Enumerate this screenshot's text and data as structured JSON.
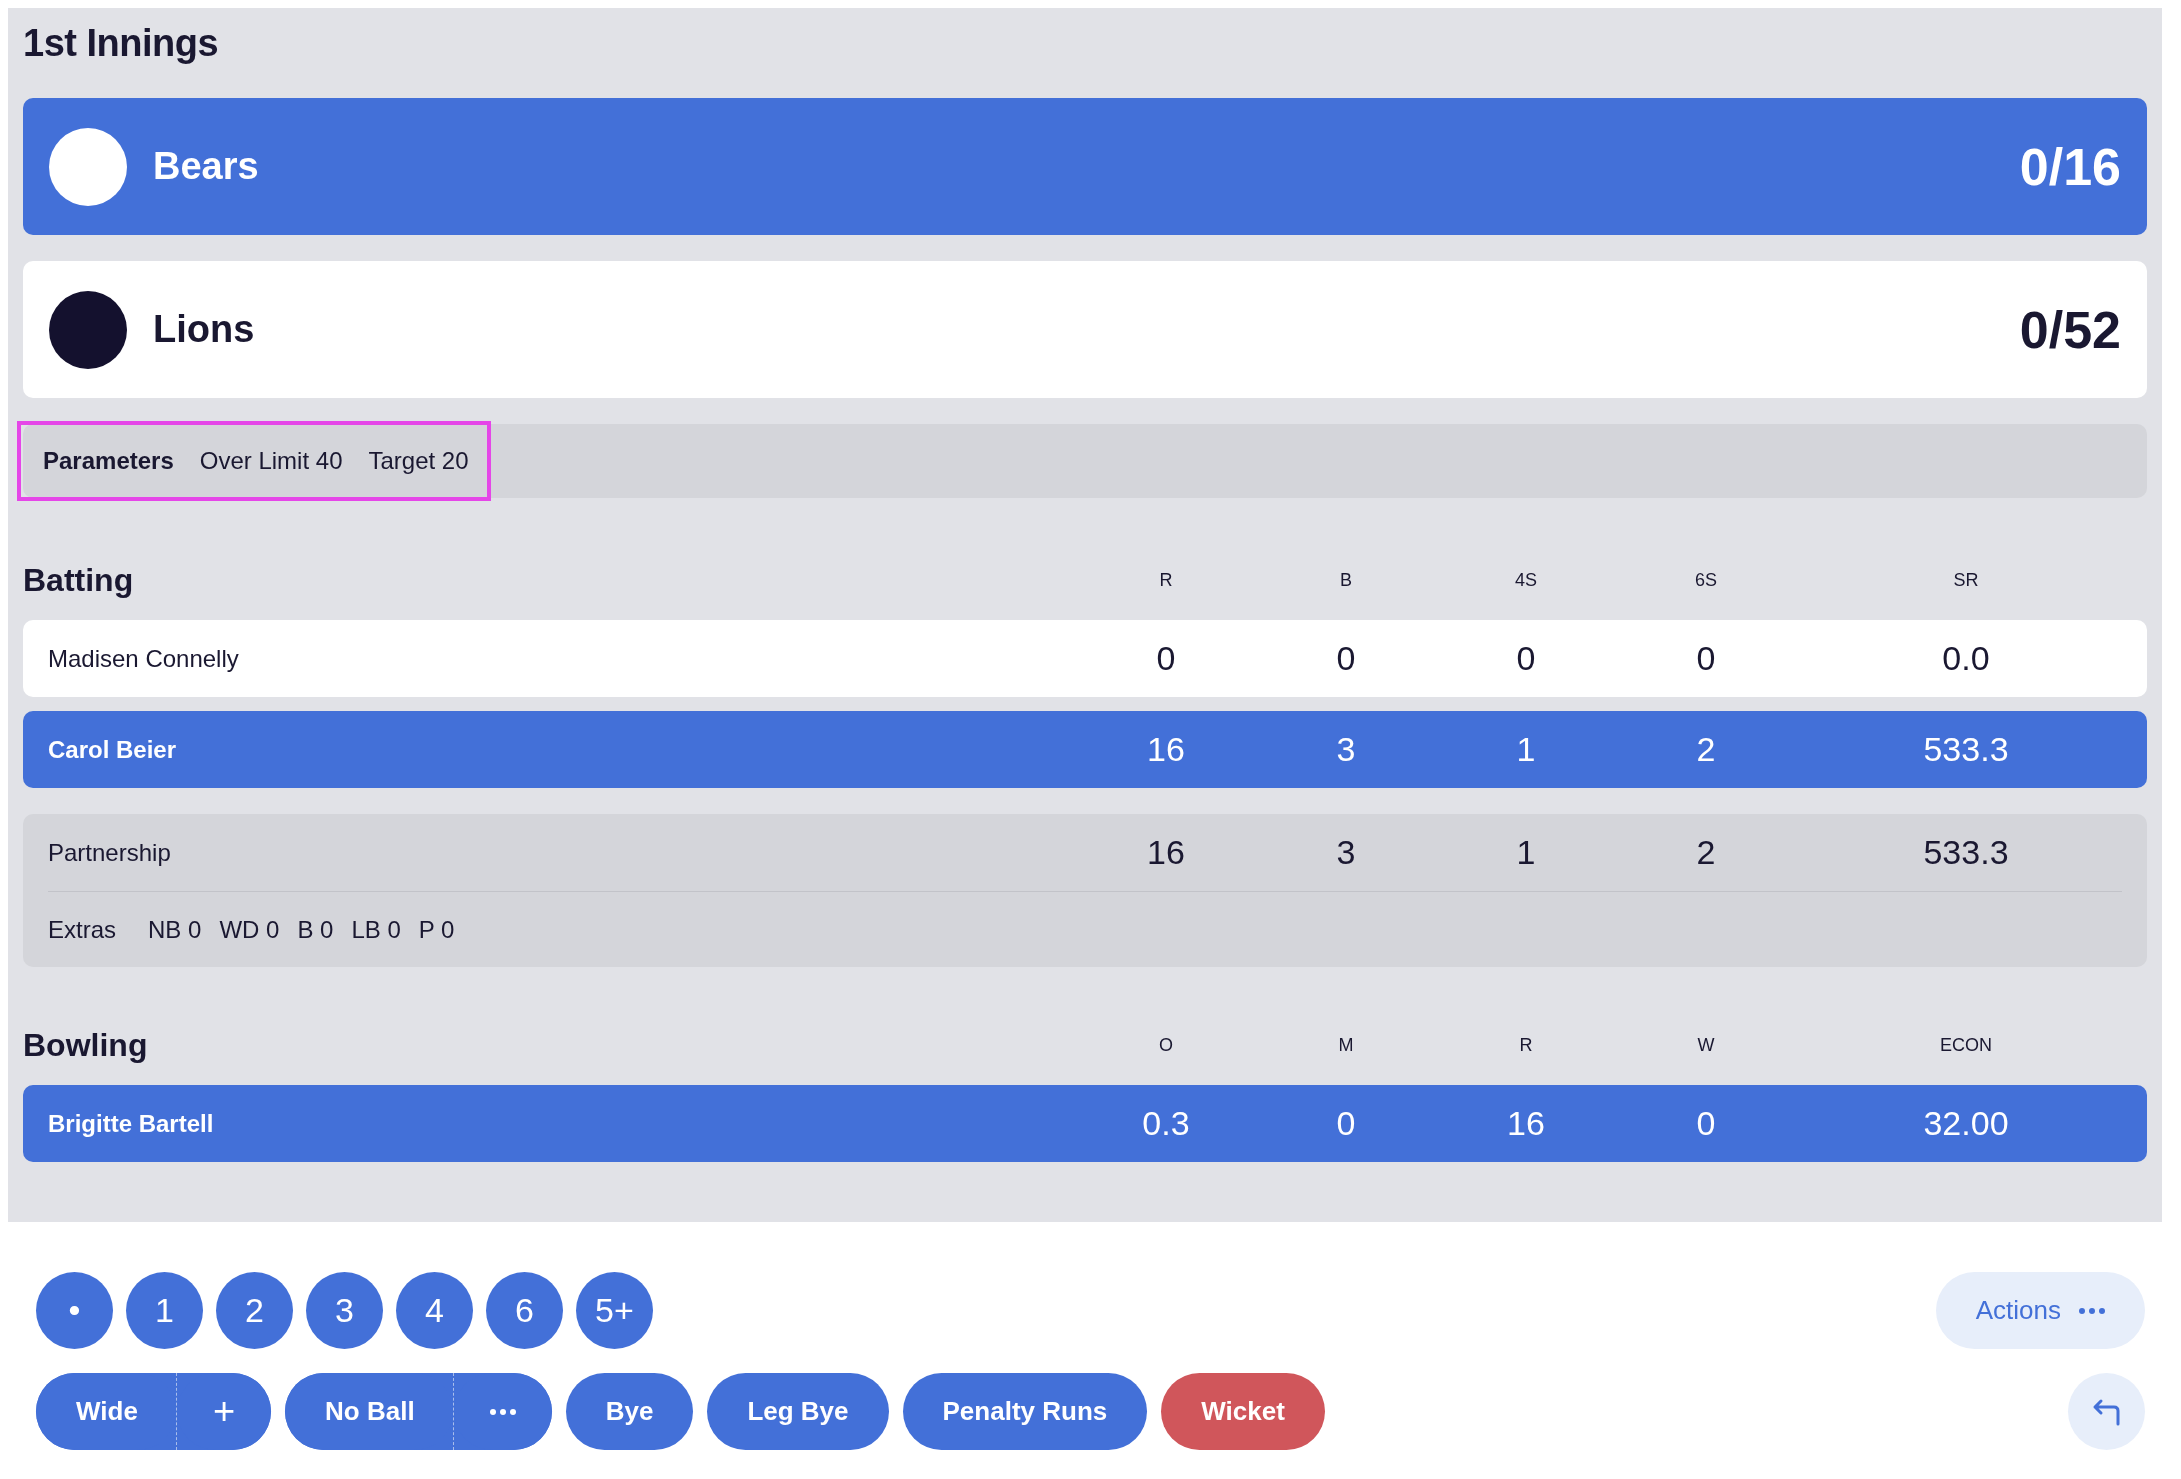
{
  "innings": {
    "title": "1st Innings",
    "teams": [
      {
        "name": "Bears",
        "score": "0/16",
        "color": "#ffffff",
        "batting": true
      },
      {
        "name": "Lions",
        "score": "0/52",
        "color": "#14112e",
        "batting": false
      }
    ],
    "parameters": {
      "label": "Parameters",
      "items": [
        "Over Limit 40",
        "Target 20"
      ],
      "highlighted": true
    },
    "batting": {
      "title": "Batting",
      "columns": [
        "R",
        "B",
        "4S",
        "6S",
        "SR"
      ],
      "rows": [
        {
          "name": "Madisen Connelly",
          "values": [
            "0",
            "0",
            "0",
            "0",
            "0.0"
          ],
          "current": false
        },
        {
          "name": "Carol Beier",
          "values": [
            "16",
            "3",
            "1",
            "2",
            "533.3"
          ],
          "current": true
        }
      ],
      "partnership": {
        "label": "Partnership",
        "values": [
          "16",
          "3",
          "1",
          "2",
          "533.3"
        ]
      },
      "extras": {
        "label": "Extras",
        "items": [
          "NB 0",
          "WD 0",
          "B 0",
          "LB 0",
          "P 0"
        ]
      }
    },
    "bowling": {
      "title": "Bowling",
      "columns": [
        "O",
        "M",
        "R",
        "W",
        "ECON"
      ],
      "rows": [
        {
          "name": "Brigitte Bartell",
          "values": [
            "0.3",
            "0",
            "16",
            "0",
            "32.00"
          ],
          "current": true
        }
      ]
    }
  },
  "controls": {
    "runs": [
      "•",
      "1",
      "2",
      "3",
      "4",
      "6",
      "5+"
    ],
    "extras": [
      {
        "kind": "split",
        "label": "Wide",
        "side": "+"
      },
      {
        "kind": "split-more",
        "label": "No Ball"
      },
      {
        "kind": "plain",
        "label": "Bye"
      },
      {
        "kind": "plain",
        "label": "Leg Bye"
      },
      {
        "kind": "plain",
        "label": "Penalty Runs"
      },
      {
        "kind": "danger",
        "label": "Wicket"
      }
    ],
    "actions": {
      "label": "Actions"
    }
  }
}
